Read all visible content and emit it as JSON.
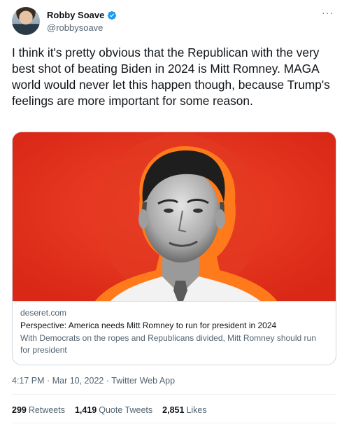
{
  "author": {
    "display_name": "Robby Soave",
    "handle": "@robbysoave",
    "verified": true
  },
  "tweet": {
    "text": "I think it's pretty obvious that the Republican with the very best shot of beating Biden in 2024 is Mitt Romney. MAGA world would never let this happen though, because Trump's feelings are more important for some reason.",
    "more_label": "···"
  },
  "card": {
    "domain": "deseret.com",
    "title": "Perspective: America needs Mitt Romney to run for president in 2024",
    "description": "With Democrats on the ropes and Republicans divided, Mitt Romney should run for president"
  },
  "meta": {
    "time": "4:17 PM",
    "sep1": "·",
    "date": "Mar 10, 2022",
    "sep2": "·",
    "source": "Twitter Web App"
  },
  "stats": {
    "retweets_count": "299",
    "retweets_label": "Retweets",
    "quotes_count": "1,419",
    "quotes_label": "Quote Tweets",
    "likes_count": "2,851",
    "likes_label": "Likes"
  },
  "colors": {
    "accent": "#1d9bf0",
    "card_bg": "#e8321f",
    "halo": "#ff7a1a"
  }
}
